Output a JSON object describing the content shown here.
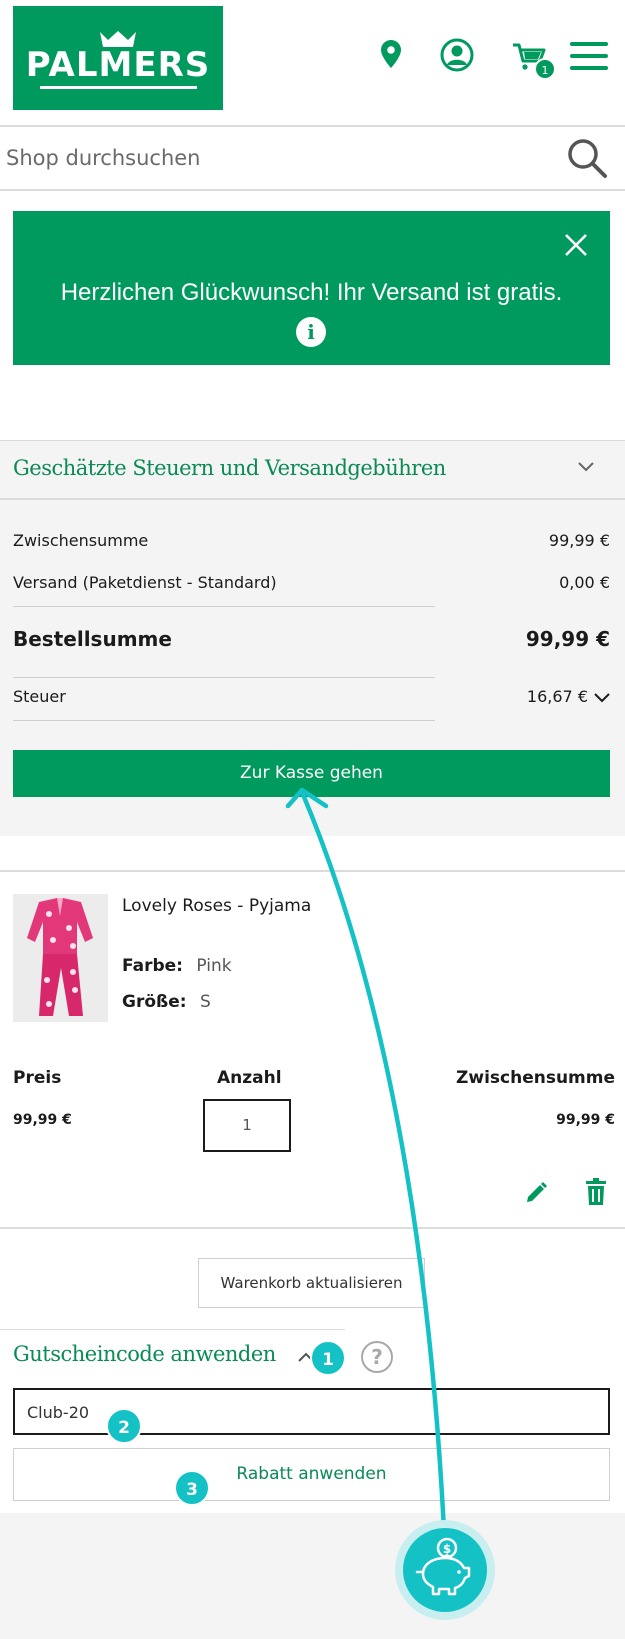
{
  "brand": {
    "logo_text": "PALMERS",
    "color": "#009a5e"
  },
  "header": {
    "icons": [
      "location-pin-icon",
      "account-icon",
      "cart-icon",
      "menu-icon"
    ],
    "cart_count": "1"
  },
  "search": {
    "placeholder": "Shop durchsuchen",
    "icon": "search-icon"
  },
  "banner": {
    "message": "Herzlichen Glückwunsch! Ihr Versand ist gratis.",
    "info_glyph": "i",
    "close_icon": "close-icon"
  },
  "summary": {
    "title": "Geschätzte Steuern und Versandgebühren",
    "subtotal_label": "Zwischensumme",
    "subtotal_value": "99,99 €",
    "shipping_label": "Versand (Paketdienst - Standard)",
    "shipping_value": "0,00 €",
    "total_label": "Bestellsumme",
    "total_value": "99,99 €",
    "tax_label": "Steuer",
    "tax_value": "16,67 €",
    "checkout_label": "Zur Kasse gehen"
  },
  "product": {
    "name": "Lovely Roses - Pyjama",
    "color_label": "Farbe:",
    "color_value": "Pink",
    "size_label": "Größe:",
    "size_value": "S",
    "price_header": "Preis",
    "qty_header": "Anzahl",
    "subtotal_header": "Zwischensumme",
    "price_value": "99,99 €",
    "qty_value": "1",
    "subtotal_value": "99,99 €"
  },
  "cart_actions": {
    "update_label": "Warenkorb aktualisieren"
  },
  "coupon": {
    "title": "Gutscheincode anwenden",
    "help_glyph": "?",
    "code_value": "Club-20",
    "apply_label": "Rabatt anwenden"
  },
  "steps": [
    "1",
    "2",
    "3"
  ],
  "accent_colors": {
    "green": "#009a5e",
    "teal": "#14c2c6"
  }
}
